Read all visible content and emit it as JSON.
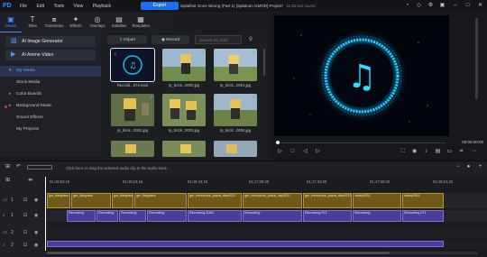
{
  "menu": {
    "logo": "PD",
    "items": [
      "File",
      "Edit",
      "Tools",
      "View",
      "Playback"
    ],
    "export_label": "Export",
    "project_title": "Splatfest Gone Wrong (Part 1) [Splatoon GMOD] Project*",
    "saved_status": "11:35 last saved"
  },
  "tabs": [
    {
      "label": "Media",
      "icon": "media-icon"
    },
    {
      "label": "Titles",
      "icon": "titles-icon"
    },
    {
      "label": "Transitions",
      "icon": "transitions-icon"
    },
    {
      "label": "Effects",
      "icon": "effects-icon"
    },
    {
      "label": "Overlays",
      "icon": "overlays-icon"
    },
    {
      "label": "Subtitles",
      "icon": "subtitles-icon"
    },
    {
      "label": "Templates",
      "icon": "templates-icon"
    }
  ],
  "left": {
    "ai_image": "AI Image Generator",
    "ai_anime": "AI Anime Video",
    "nav": [
      "My Media",
      "Stock Media",
      "Color Boards",
      "Background Music",
      "Sound Effects",
      "My Projects"
    ]
  },
  "media": {
    "import_label": "Import",
    "record_label": "Record",
    "search_placeholder": "Search my med",
    "items": [
      {
        "caption": "Recordi...574.mp3"
      },
      {
        "caption": "rp_brick...0000.jpg"
      },
      {
        "caption": "rp_brick...0001.jpg"
      },
      {
        "caption": "rp_brick...0002.jpg"
      },
      {
        "caption": "rp_brick...0003.jpg"
      },
      {
        "caption": "rp_brick...0004.jpg"
      },
      {
        "caption": ""
      },
      {
        "caption": ""
      },
      {
        "caption": ""
      }
    ]
  },
  "preview": {
    "timecode": "00:00:00:00",
    "colors": {
      "ring": "#27d4ff",
      "note": "#2fe0ff"
    }
  },
  "timeline": {
    "hint": "Click here or drag the selected audio clip to the audio track.",
    "ticks": [
      "01;15;54;16",
      "01;16;19;18",
      "01;16;44;18",
      "01;17;09;20",
      "01;17;34;20",
      "01;17;59;20",
      "01;18;24;22"
    ],
    "track_numbers": [
      "1",
      "1",
      "2",
      "2"
    ],
    "video_clips": [
      "gm_flatgrass",
      "gm_flatgrass",
      "gm_flatgrass",
      "gm_flatgrass",
      "gm_intrepsnik_plaza_day0011",
      "gm_intrepsnik_plaza_day0011",
      "gm_intrepsnik_plaza_day0011",
      "valley0011",
      "valley0011"
    ],
    "audio_clips": [
      "Recording",
      "Recording",
      "Recording",
      "Recording",
      "Recording 1084",
      "Recording",
      "Recording 071",
      "Recording",
      "Recording 071"
    ]
  }
}
